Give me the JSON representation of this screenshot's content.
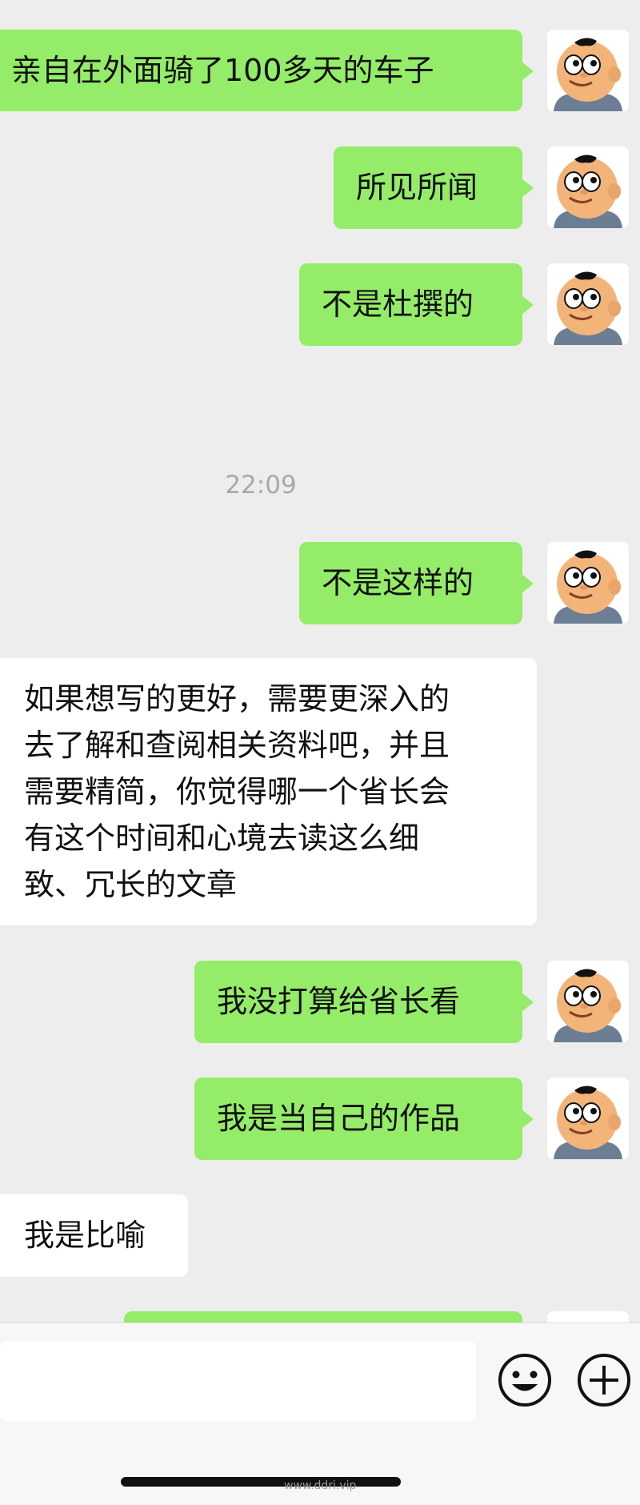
{
  "chat": {
    "messages": [
      {
        "side": "sent",
        "text": "亲自在外面骑了100多天的车子"
      },
      {
        "side": "sent",
        "text": "所见所闻"
      },
      {
        "side": "sent",
        "text": "不是杜撰的"
      },
      {
        "side": "sent",
        "text": "不是这样的"
      },
      {
        "side": "received",
        "lines": [
          "如果想写的更好，需要更深入的",
          "去了解和查阅相关资料吧，并且",
          "需要精简，你觉得哪一个省长会",
          "有这个时间和心境去读这么细",
          "致、冗长的文章"
        ]
      },
      {
        "side": "sent",
        "text": "我没打算给省长看"
      },
      {
        "side": "sent",
        "text": "我是当自己的作品"
      },
      {
        "side": "received",
        "text": "我是比喻"
      }
    ],
    "timestamp": "22:09",
    "avatar_icon": "cartoon-boy-avatar-icon"
  },
  "input_bar": {
    "text_value": "",
    "emoji_icon": "smiley-icon",
    "plus_icon": "plus-icon"
  },
  "watermark": "www.ddri.vip",
  "colors": {
    "background": "#ededed",
    "sent_bubble": "#95ec69",
    "received_bubble": "#ffffff",
    "timestamp": "#a9a9a9"
  }
}
